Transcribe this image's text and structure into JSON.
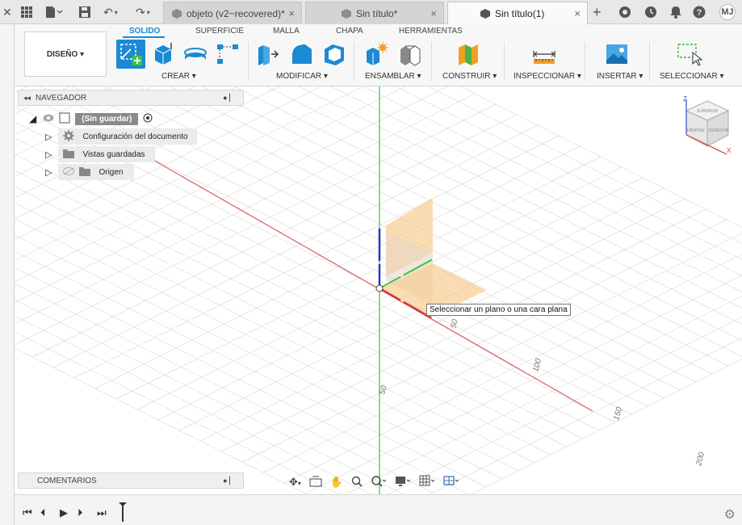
{
  "titlebar": {
    "tabs": [
      {
        "label": "objeto (v2~recovered)*",
        "active": false
      },
      {
        "label": "Sin título*",
        "active": false
      },
      {
        "label": "Sin título(1)",
        "active": true
      }
    ],
    "close_glyph": "×",
    "user_initials": "MJ"
  },
  "toolbar": {
    "workspace_label": "DISEÑO ▾",
    "workspace_tabs": [
      "SOLIDO",
      "SUPERFICIE",
      "MALLA",
      "CHAPA",
      "HERRAMIENTAS"
    ],
    "active_tab": "SOLIDO",
    "groups": [
      {
        "label": "CREAR ▾"
      },
      {
        "label": "MODIFICAR ▾"
      },
      {
        "label": "ENSAMBLAR ▾"
      },
      {
        "label": "CONSTRUIR ▾"
      },
      {
        "label": "INSPECCIONAR ▾"
      },
      {
        "label": "INSERTAR ▾"
      },
      {
        "label": "SELECCIONAR ▾"
      }
    ]
  },
  "navigator": {
    "title": "NAVEGADOR",
    "root": "(Sin guardar)",
    "items": [
      {
        "label": "Configuración del documento",
        "icon": "gear-icon"
      },
      {
        "label": "Vistas guardadas",
        "icon": "folder-icon"
      },
      {
        "label": "Origen",
        "icon": "folder-icon"
      }
    ]
  },
  "comments": {
    "title": "COMENTARIOS"
  },
  "viewport": {
    "tooltip": "Seleccionar un plano o una cara plana",
    "axis_labels": [
      "50",
      "100",
      "150",
      "200",
      "50"
    ],
    "viewcube": {
      "top": "SUPERIOR",
      "front": "FRONTAL",
      "right": "DERECHA",
      "axis_z": "Z",
      "axis_x": "X"
    }
  },
  "colors": {
    "accent": "#1a8ad4",
    "x_axis": "#d33b3b",
    "y_axis": "#3ec43e",
    "z_axis": "#1f3fb8",
    "plane": "#f7c98a"
  }
}
